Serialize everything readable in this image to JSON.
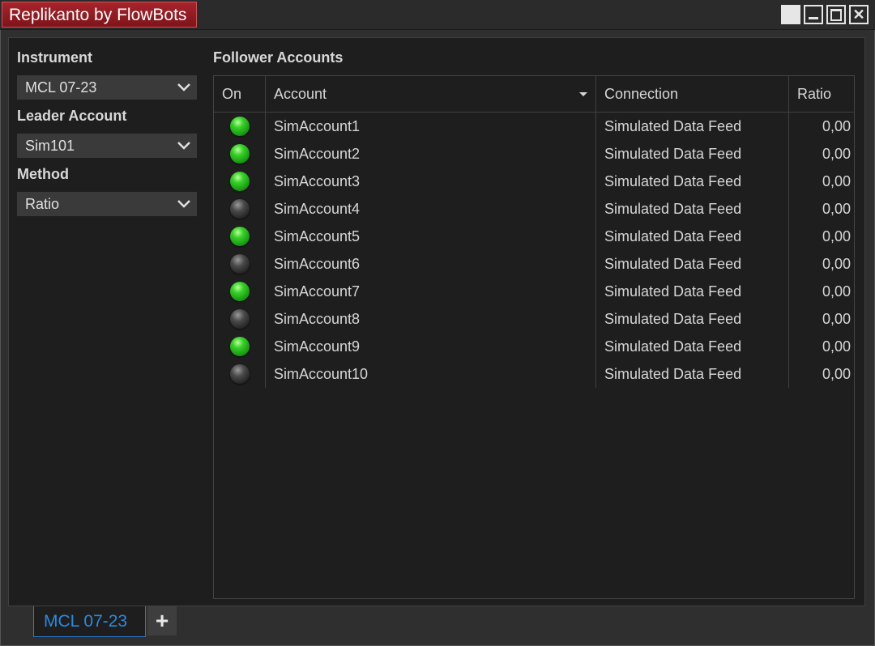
{
  "window": {
    "title": "Replikanto by FlowBots"
  },
  "left_panel": {
    "instrument_label": "Instrument",
    "instrument_value": "MCL 07-23",
    "leader_label": "Leader Account",
    "leader_value": "Sim101",
    "method_label": "Method",
    "method_value": "Ratio"
  },
  "followers": {
    "title": "Follower Accounts",
    "columns": {
      "on": "On",
      "account": "Account",
      "connection": "Connection",
      "ratio": "Ratio"
    },
    "rows": [
      {
        "on": true,
        "account": "SimAccount1",
        "connection": "Simulated Data Feed",
        "ratio": "0,00"
      },
      {
        "on": true,
        "account": "SimAccount2",
        "connection": "Simulated Data Feed",
        "ratio": "0,00"
      },
      {
        "on": true,
        "account": "SimAccount3",
        "connection": "Simulated Data Feed",
        "ratio": "0,00"
      },
      {
        "on": false,
        "account": "SimAccount4",
        "connection": "Simulated Data Feed",
        "ratio": "0,00"
      },
      {
        "on": true,
        "account": "SimAccount5",
        "connection": "Simulated Data Feed",
        "ratio": "0,00"
      },
      {
        "on": false,
        "account": "SimAccount6",
        "connection": "Simulated Data Feed",
        "ratio": "0,00"
      },
      {
        "on": true,
        "account": "SimAccount7",
        "connection": "Simulated Data Feed",
        "ratio": "0,00"
      },
      {
        "on": false,
        "account": "SimAccount8",
        "connection": "Simulated Data Feed",
        "ratio": "0,00"
      },
      {
        "on": true,
        "account": "SimAccount9",
        "connection": "Simulated Data Feed",
        "ratio": "0,00"
      },
      {
        "on": false,
        "account": "SimAccount10",
        "connection": "Simulated Data Feed",
        "ratio": "0,00"
      }
    ]
  },
  "bottom_tabs": {
    "active_tab": "MCL 07-23",
    "add_label": "+"
  },
  "colors": {
    "title_accent": "#a8242b",
    "tab_active": "#2a8ae0",
    "status_on": "#38d028",
    "status_off": "#4a4a4a"
  },
  "icons": {
    "window_buttons": [
      "restore-icon",
      "minimize-icon",
      "maximize-icon",
      "close-icon"
    ],
    "dropdown": "chevron-down-icon",
    "status_on": "green-led-icon",
    "status_off": "gray-led-icon"
  }
}
